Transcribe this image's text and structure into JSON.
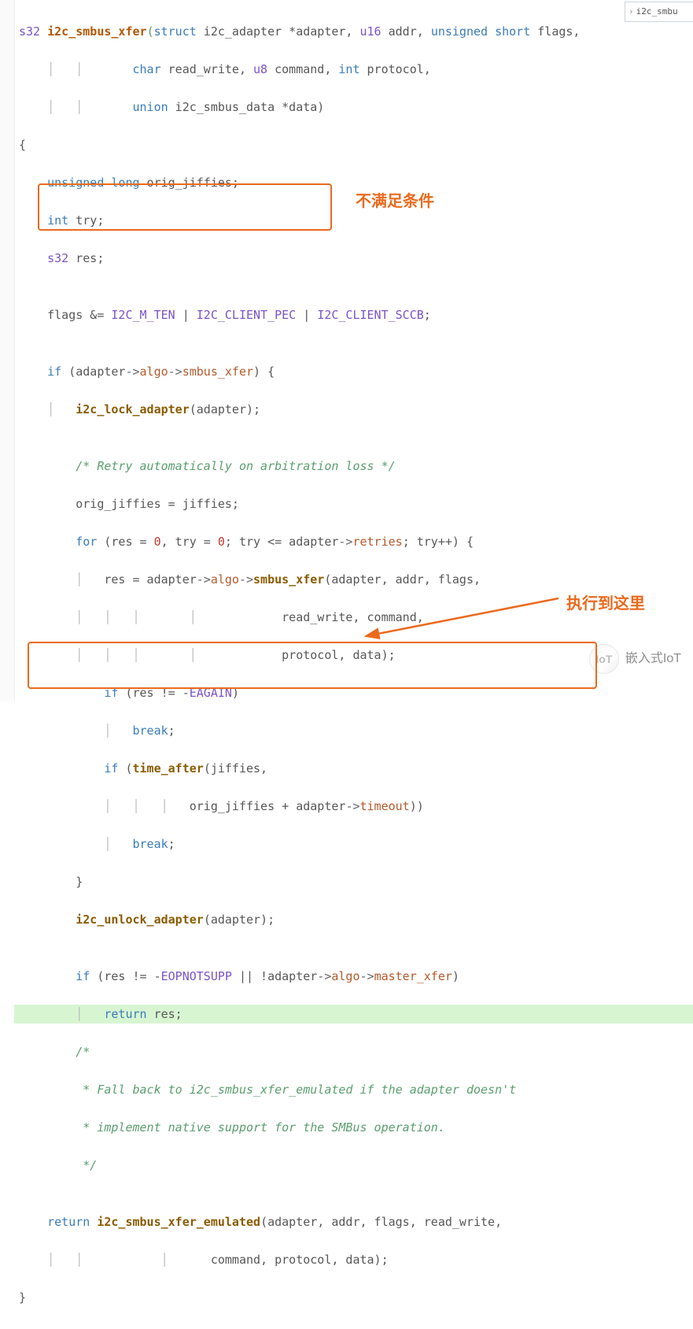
{
  "breadcrumb": {
    "arrow": "›",
    "label": "i2c_smbu"
  },
  "annotations": {
    "box1_label": "不满足条件",
    "box2_label": "执行到这里"
  },
  "watermark": {
    "icon_text": "IoT",
    "label": "嵌入式IoT"
  },
  "code": {
    "l01": {
      "t1": "s32",
      "t2": "i2c_smbus_xfer",
      "t3": "(",
      "t4": "struct",
      "t5": " i2c_adapter *adapter, ",
      "t6": "u16",
      "t7": " addr, ",
      "t8": "unsigned",
      "t9": " ",
      "t10": "short",
      "t11": " flags,"
    },
    "l02": {
      "g": "    │   │       ",
      "t1": "char",
      "t2": " read_write, ",
      "t3": "u8",
      "t4": " command, ",
      "t5": "int",
      "t6": " protocol,"
    },
    "l03": {
      "g": "    │   │       ",
      "t1": "union",
      "t2": " i2c_smbus_data *data)"
    },
    "l04": {
      "t": "{"
    },
    "l05": {
      "g": "    ",
      "t1": "unsigned",
      "t2": " ",
      "t3": "long",
      "t4": " orig_jiffies;"
    },
    "l06": {
      "g": "    ",
      "t1": "int",
      "t2": " try;"
    },
    "l07": {
      "g": "    ",
      "t1": "s32",
      "t2": " res;"
    },
    "l08": {
      "t": ""
    },
    "l09": {
      "g": "    ",
      "t1": "flags &= ",
      "t2": "I2C_M_TEN",
      "t3": " | ",
      "t4": "I2C_CLIENT_PEC",
      "t5": " | ",
      "t6": "I2C_CLIENT_SCCB",
      "t7": ";"
    },
    "l10": {
      "t": ""
    },
    "l11": {
      "g": "    ",
      "t1": "if",
      "t2": " (adapter",
      "t3": "->",
      "t4": "algo",
      "t5": "->",
      "t6": "smbus_xfer",
      "t7": ") {"
    },
    "l12": {
      "g": "    │   ",
      "t1": "i2c_lock_adapter",
      "t2": "(adapter);"
    },
    "l13": {
      "t": ""
    },
    "l14": {
      "g": "        ",
      "t1": "/* Retry automatically on arbitration loss */"
    },
    "l15": {
      "g": "        ",
      "t1": "orig_jiffies = jiffies;"
    },
    "l16": {
      "g": "        ",
      "t1": "for",
      "t2": " (res = ",
      "t3": "0",
      "t4": ", try = ",
      "t5": "0",
      "t6": "; try <= adapter",
      "t7": "->",
      "t8": "retries",
      "t9": "; try++) {"
    },
    "l17": {
      "g": "        │   ",
      "t1": "res = adapter",
      "t2": "->",
      "t3": "algo",
      "t4": "->",
      "t5": "smbus_xfer",
      "t6": "(adapter, addr, flags,"
    },
    "l18": {
      "g": "        │   │   │       │            ",
      "t1": "read_write, command,"
    },
    "l19": {
      "g": "        │   │   │       │            ",
      "t1": "protocol, data);"
    },
    "l20": {
      "g": "            ",
      "t1": "if",
      "t2": " (res != -",
      "t3": "EAGAIN",
      "t4": ")"
    },
    "l21": {
      "g": "            │   ",
      "t1": "break",
      "t2": ";"
    },
    "l22": {
      "g": "            ",
      "t1": "if",
      "t2": " (",
      "t3": "time_after",
      "t4": "(jiffies,"
    },
    "l23": {
      "g": "            │   │   │   ",
      "t1": "orig_jiffies + adapter",
      "t2": "->",
      "t3": "timeout",
      "t4": "))"
    },
    "l24": {
      "g": "            │   ",
      "t1": "break",
      "t2": ";"
    },
    "l25": {
      "g": "        ",
      "t1": "}"
    },
    "l26": {
      "g": "        ",
      "t1": "i2c_unlock_adapter",
      "t2": "(adapter);"
    },
    "l27": {
      "t": ""
    },
    "l28": {
      "g": "        ",
      "t1": "if",
      "t2": " (res != -",
      "t3": "EOPNOTSUPP",
      "t4": " || !adapter",
      "t5": "->",
      "t6": "algo",
      "t7": "->",
      "t8": "master_xfer",
      "t9": ")"
    },
    "l29": {
      "g": "        │   ",
      "t1": "return",
      "t2": " res;"
    },
    "l30": {
      "g": "        ",
      "t1": "/*"
    },
    "l31": {
      "g": "         ",
      "t1": "* Fall back to i2c_smbus_xfer_emulated if the adapter doesn't"
    },
    "l32": {
      "g": "         ",
      "t1": "* implement native support for the SMBus operation."
    },
    "l33": {
      "g": "         ",
      "t1": "*/"
    },
    "l34": {
      "t": ""
    },
    "l35": {
      "g": "    ",
      "t1": "return",
      "t2": " ",
      "t3": "i2c_smbus_xfer_emulated",
      "t4": "(adapter, addr, flags, read_write,"
    },
    "l36": {
      "g": "    │   │           │      ",
      "t1": "command, protocol, data);"
    },
    "l37": {
      "t": "}"
    }
  }
}
